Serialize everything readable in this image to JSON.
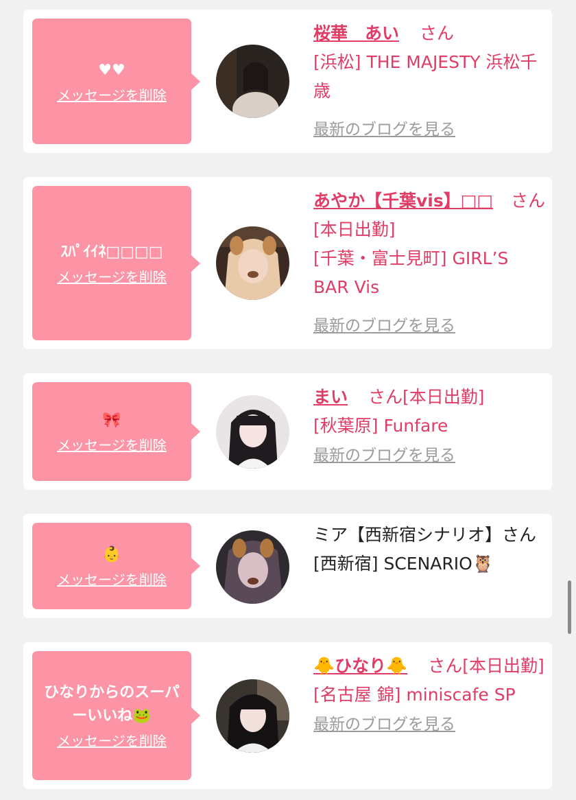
{
  "cards": [
    {
      "message": "♥♥",
      "delete_label": "メッセージを削除",
      "name": "桜華　あい",
      "honorific": "さん",
      "store": "[浜松] THE MAJESTY 浜松千歳",
      "blog_label": "最新のブログを見る"
    },
    {
      "message": "ｽﾊﾟｲｲﾈ□□□□",
      "delete_label": "メッセージを削除",
      "name": "あやか【千葉vis】□□",
      "honorific": "さん",
      "status": "[本日出勤]",
      "store": "[千葉・富士見町] GIRL’S BAR Vis",
      "blog_label": "最新のブログを見る"
    },
    {
      "message": "🎀",
      "delete_label": "メッセージを削除",
      "name": "まい",
      "honorific": "さん",
      "status": "[本日出勤]",
      "store": "[秋葉原] Funfare",
      "blog_label": "最新のブログを見る"
    },
    {
      "message": "👶",
      "delete_label": "メッセージを削除",
      "name": "ミア【西新宿シナリオ】さん",
      "store": "[西新宿] SCENARIO🦉"
    },
    {
      "message": "ひなりからのスーパーいいね🐸",
      "delete_label": "メッセージを削除",
      "name": "🐥ひなり🐥",
      "honorific": "さん",
      "status": "[本日出勤]",
      "store": "[名古屋 錦] miniscafe SP",
      "blog_label": "最新のブログを見る"
    }
  ],
  "colors": {
    "bubble": "#fc94a6",
    "accent": "#e03c66",
    "link_gray": "#9b9b9b",
    "background": "#f1f1f1"
  }
}
